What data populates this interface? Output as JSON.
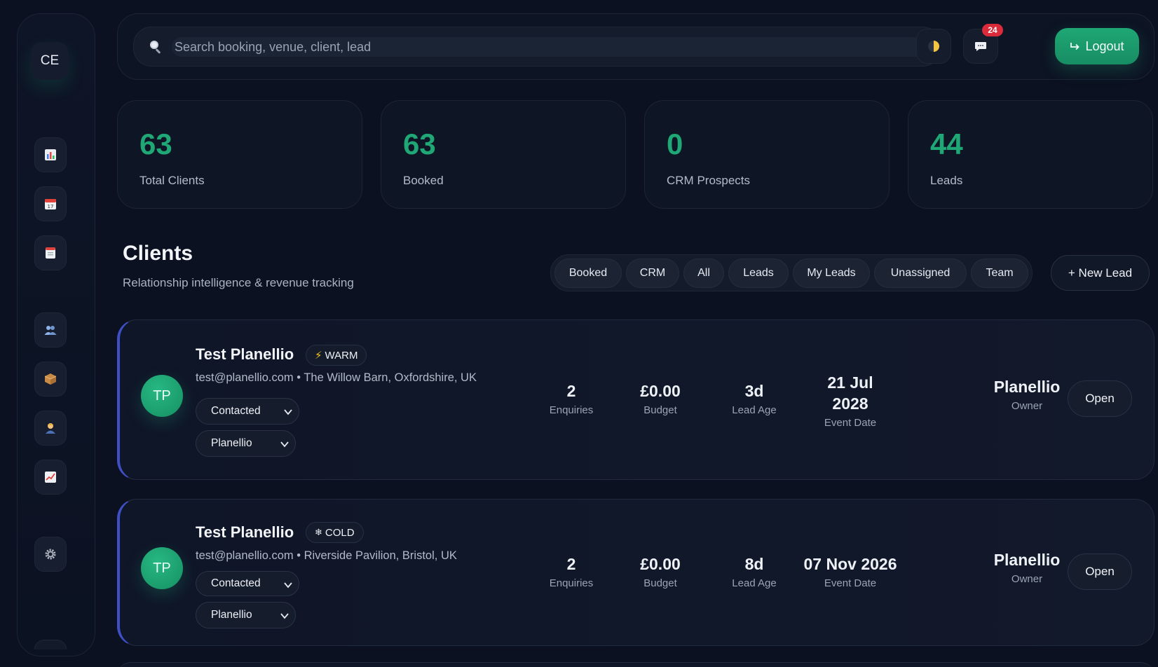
{
  "user": {
    "initials": "CE"
  },
  "sidebar": {
    "items": [
      {
        "name": "dashboard",
        "icon": "bar-chart-icon"
      },
      {
        "name": "calendar",
        "icon": "calendar-icon"
      },
      {
        "name": "notes",
        "icon": "notepad-icon"
      },
      {
        "name": "clients",
        "icon": "people-icon"
      },
      {
        "name": "packages",
        "icon": "package-icon"
      },
      {
        "name": "staff",
        "icon": "person-icon"
      },
      {
        "name": "analytics",
        "icon": "trend-chart-icon"
      },
      {
        "name": "settings",
        "icon": "gear-icon"
      }
    ]
  },
  "search": {
    "placeholder": "Search booking, venue, client, lead"
  },
  "header": {
    "notifications_count": "24",
    "logout_label": "Logout"
  },
  "stats": [
    {
      "value": "63",
      "label": "Total Clients"
    },
    {
      "value": "63",
      "label": "Booked"
    },
    {
      "value": "0",
      "label": "CRM Prospects"
    },
    {
      "value": "44",
      "label": "Leads"
    }
  ],
  "clients_section": {
    "title": "Clients",
    "subtitle": "Relationship intelligence & revenue tracking",
    "filters": [
      "Booked",
      "CRM",
      "All",
      "Leads",
      "My Leads",
      "Unassigned",
      "Team"
    ],
    "new_lead_label": "+ New Lead"
  },
  "clients": [
    {
      "initials": "TP",
      "name": "Test Planellio",
      "temperature": "WARM",
      "temperature_icon": "⚡",
      "email": "test@planellio.com",
      "venue": "The Willow Barn, Oxfordshire, UK",
      "status": "Contacted",
      "assignee": "Planellio",
      "enquiries": "2",
      "enquiries_label": "Enquiries",
      "budget": "£0.00",
      "budget_label": "Budget",
      "lead_age": "3d",
      "lead_age_label": "Lead Age",
      "event_date_line1": "21 Jul",
      "event_date_line2": "2028",
      "event_date_label": "Event Date",
      "owner": "Planellio",
      "owner_label": "Owner",
      "open_label": "Open"
    },
    {
      "initials": "TP",
      "name": "Test Planellio",
      "temperature": "COLD",
      "temperature_icon": "❄",
      "email": "test@planellio.com",
      "venue": "Riverside Pavilion, Bristol, UK",
      "status": "Contacted",
      "assignee": "Planellio",
      "enquiries": "2",
      "enquiries_label": "Enquiries",
      "budget": "£0.00",
      "budget_label": "Budget",
      "lead_age": "8d",
      "lead_age_label": "Lead Age",
      "event_date": "07 Nov 2026",
      "event_date_label": "Event Date",
      "owner": "Planellio",
      "owner_label": "Owner",
      "open_label": "Open"
    }
  ],
  "meta_separator": "•",
  "colors": {
    "accent": "#1fa876",
    "background": "#0b1120",
    "card_left_border": "#3f4fc6",
    "badge": "#d92b3a"
  }
}
